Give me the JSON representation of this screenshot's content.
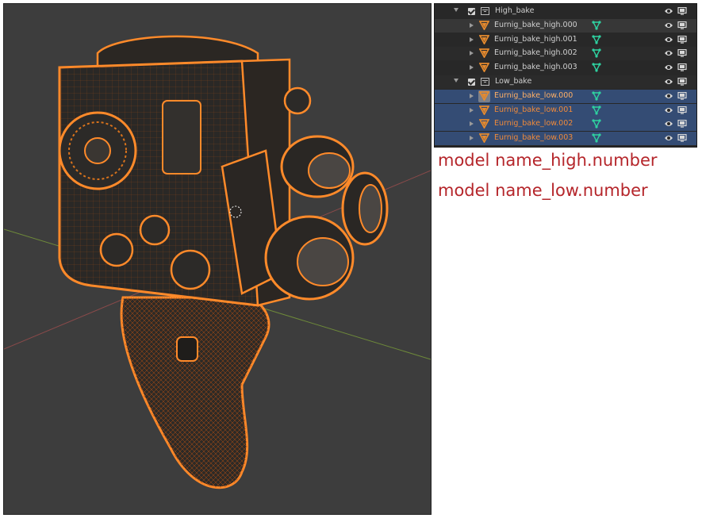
{
  "outliner": {
    "rows": [
      {
        "kind": "collection",
        "label": "High_bake",
        "depth": 1,
        "expanded": true,
        "checked": true,
        "selected": false
      },
      {
        "kind": "object",
        "label": "Eurnig_bake_high.000",
        "depth": 2,
        "selected": false,
        "active": false
      },
      {
        "kind": "object",
        "label": "Eurnig_bake_high.001",
        "depth": 2,
        "selected": false,
        "active": false
      },
      {
        "kind": "object",
        "label": "Eurnig_bake_high.002",
        "depth": 2,
        "selected": false,
        "active": false
      },
      {
        "kind": "object",
        "label": "Eurnig_bake_high.003",
        "depth": 2,
        "selected": false,
        "active": false
      },
      {
        "kind": "collection",
        "label": "Low_bake",
        "depth": 1,
        "expanded": true,
        "checked": true,
        "selected": false
      },
      {
        "kind": "object",
        "label": "Eurnig_bake_low.000",
        "depth": 2,
        "selected": true,
        "active": true
      },
      {
        "kind": "object",
        "label": "Eurnig_bake_low.001",
        "depth": 2,
        "selected": true,
        "active": false
      },
      {
        "kind": "object",
        "label": "Eurnig_bake_low.002",
        "depth": 2,
        "selected": true,
        "active": false
      },
      {
        "kind": "object",
        "label": "Eurnig_bake_low.003",
        "depth": 2,
        "selected": true,
        "active": false
      }
    ],
    "icons": {
      "expand": "chevron-icon",
      "visibility": "eye-icon",
      "render": "monitor-icon",
      "collection": "collection-icon",
      "mesh": "mesh-triangle-icon",
      "modifier": "vertex-group-icon"
    }
  },
  "annotations": {
    "line1": "model name_high.number",
    "line2": "model name_low.number"
  },
  "colors": {
    "annotation": "#b5262b",
    "selection": "#344c74",
    "wire": "#e8731a",
    "mesh_icon": "#e58a2e",
    "modifier_icon": "#2fd1a0",
    "viewport_bg": "#3d3d3d"
  }
}
